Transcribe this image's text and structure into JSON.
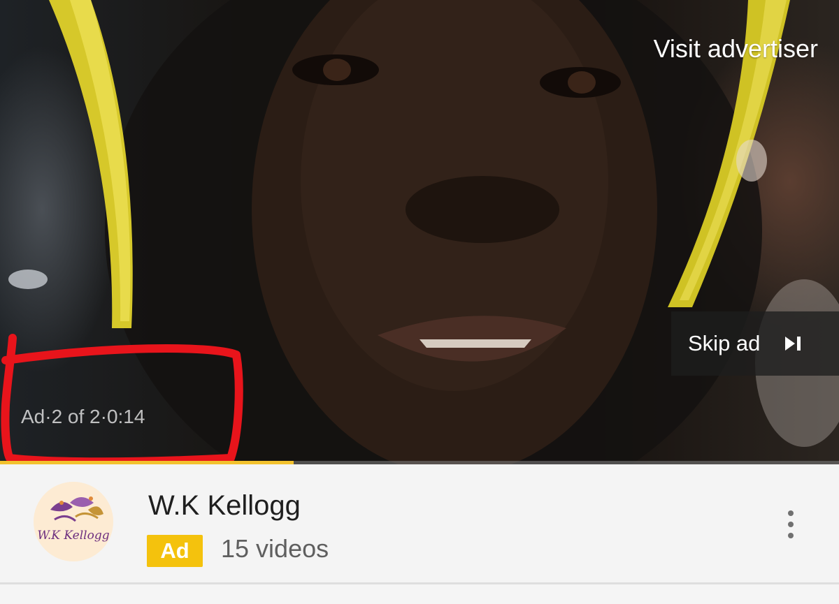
{
  "player": {
    "visit_advertiser_label": "Visit advertiser",
    "skip_ad_label": "Skip ad",
    "skip_icon": "skip-next-icon",
    "ad_counter_text": "Ad·2 of 2·0:14",
    "progress_fraction": 0.35,
    "progress_color": "#f2c12e",
    "annotation_color": "#e8141b"
  },
  "channel": {
    "avatar_icon": "kellogg-logo",
    "avatar_text": "W.K Kellogg",
    "name": "W.K Kellogg",
    "ad_badge_label": "Ad",
    "ad_badge_color": "#f4c20d",
    "video_count": "15 videos",
    "more_icon": "more-vert-icon"
  }
}
